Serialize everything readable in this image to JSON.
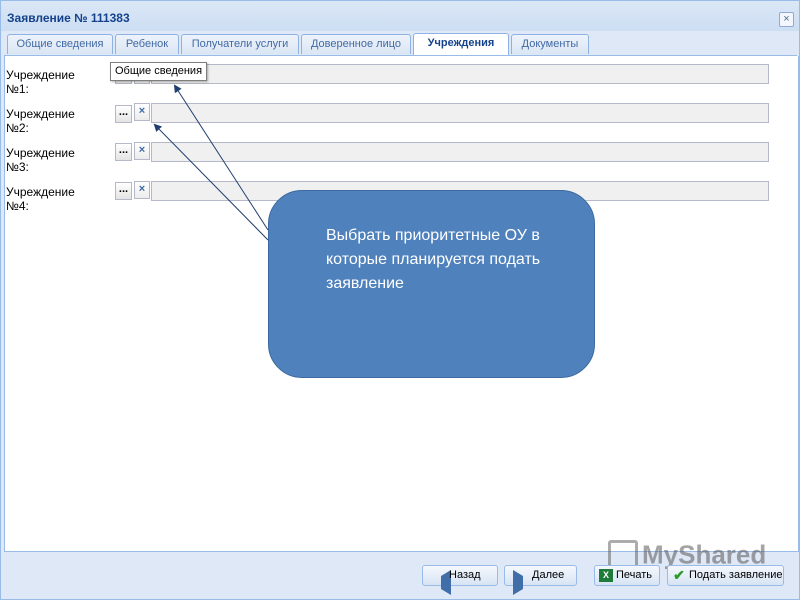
{
  "window": {
    "title": "Заявление № 111383",
    "close_label": "×"
  },
  "tabs": [
    {
      "label": "Общие сведения",
      "active": false
    },
    {
      "label": "Ребенок",
      "active": false
    },
    {
      "label": "Получатели услуги",
      "active": false
    },
    {
      "label": "Доверенное лицо",
      "active": false
    },
    {
      "label": "Учреждения",
      "active": true
    },
    {
      "label": "Документы",
      "active": false
    }
  ],
  "rows": [
    {
      "label_line1": "Учреждение",
      "label_line2": "№1:",
      "value": ""
    },
    {
      "label_line1": "Учреждение",
      "label_line2": "№2:",
      "value": ""
    },
    {
      "label_line1": "Учреждение",
      "label_line2": "№3:",
      "value": ""
    },
    {
      "label_line1": "Учреждение",
      "label_line2": "№4:",
      "value": ""
    }
  ],
  "pick_label": "...",
  "clear_label": "×",
  "tooltip": "Общие сведения",
  "callout": {
    "text": "Выбрать приоритетные ОУ в которые планируется подать заявление"
  },
  "watermark": "MyShared",
  "footer": {
    "back": "Назад",
    "next": "Далее",
    "print": "Печать",
    "submit": "Подать заявление"
  },
  "colors": {
    "callout": "#4f81bd",
    "window_border": "#99bbe8",
    "title_text": "#15428b",
    "background": "#dfe8f6"
  },
  "icons": [
    "close-icon",
    "arrow-left-icon",
    "arrow-right-icon",
    "excel-icon",
    "checkmark-icon"
  ]
}
